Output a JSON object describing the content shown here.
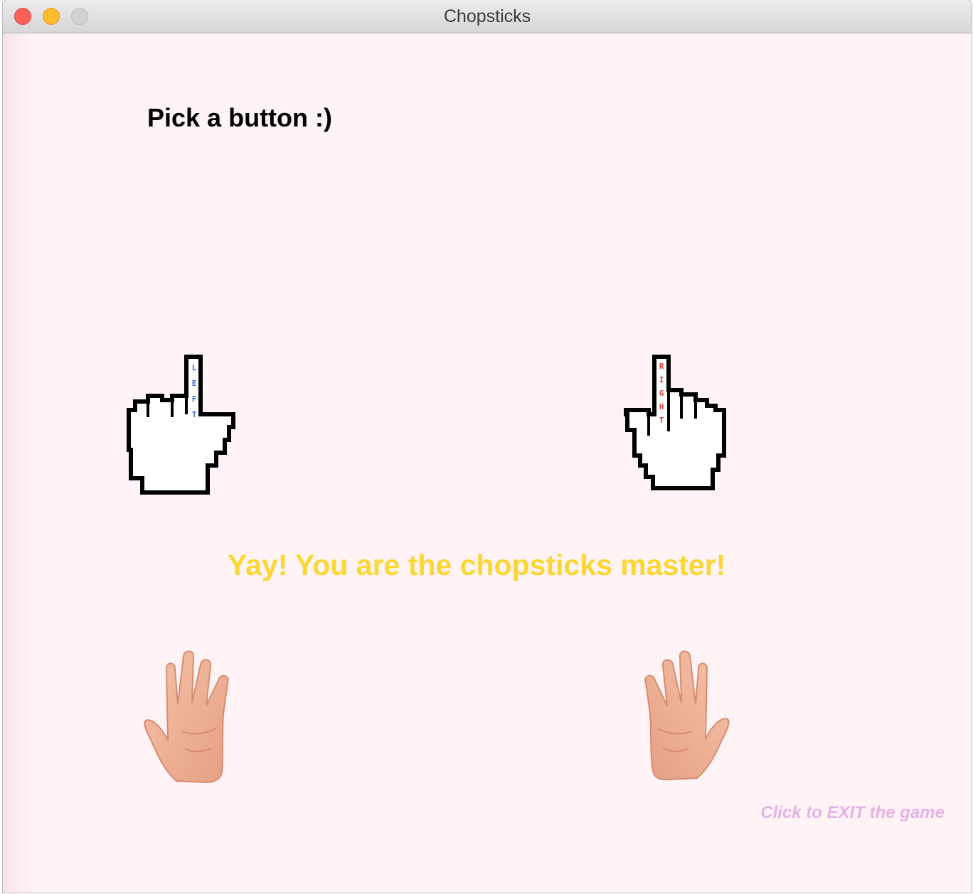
{
  "window": {
    "title": "Chopsticks"
  },
  "main": {
    "prompt": "Pick a button :)",
    "left_button_letters": [
      "L",
      "E",
      "F",
      "T"
    ],
    "right_button_letters": [
      "R",
      "I",
      "G",
      "H",
      "T"
    ],
    "message": "Yay! You are the chopsticks master!",
    "exit_label": "Click to EXIT the game",
    "left_hand_fingers": 5,
    "right_hand_fingers": 5
  },
  "colors": {
    "background": "#fff3f6",
    "message": "#fbd634",
    "exit_link": "#e4b2e6",
    "left_letters": "#3a66d6",
    "right_letters": "#e63b3b"
  },
  "icons": {
    "left_button": "pointing-hand-cursor-icon",
    "right_button": "pointing-hand-cursor-icon",
    "left_hand": "open-hand-icon",
    "right_hand": "open-hand-icon"
  }
}
